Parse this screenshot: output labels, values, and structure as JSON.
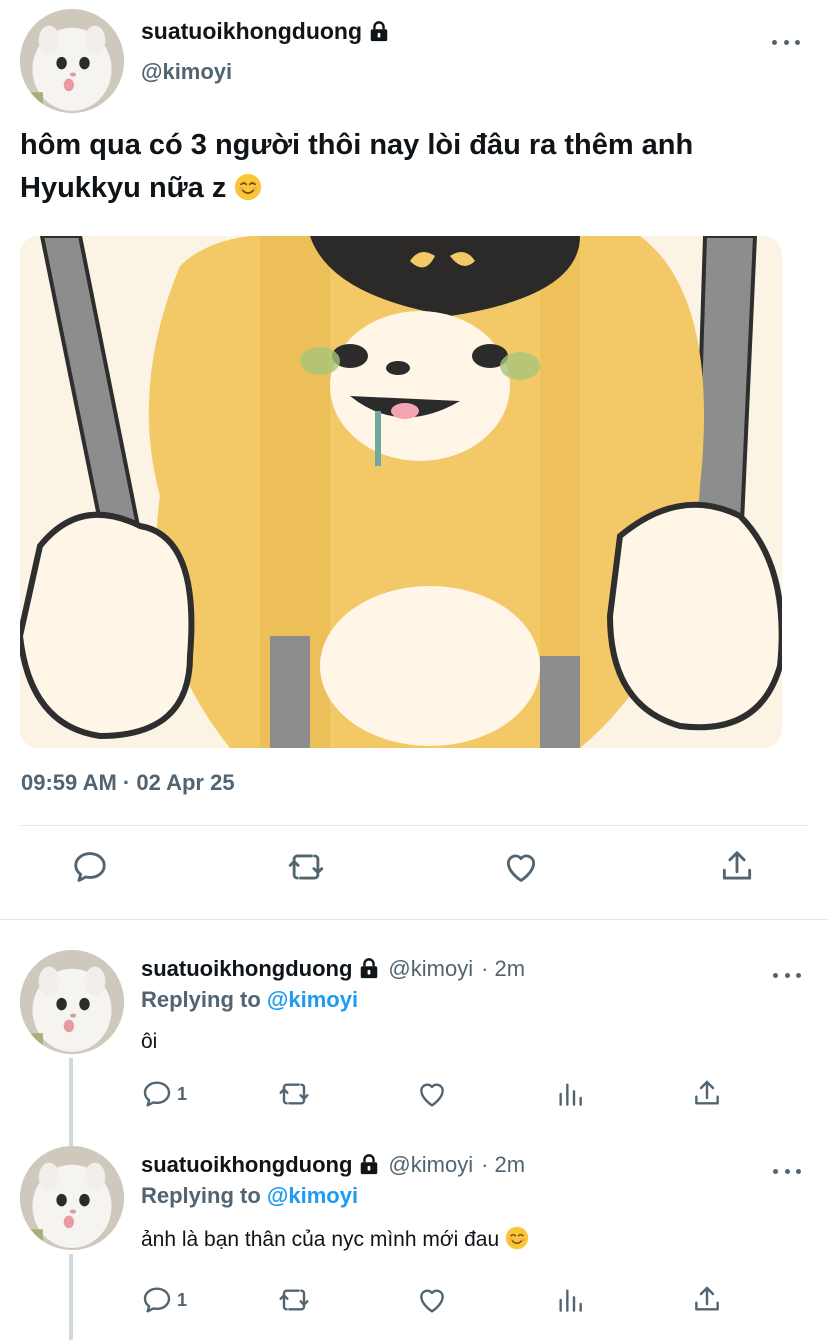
{
  "main_tweet": {
    "display_name": "suatuoikhongduong",
    "handle": "@kimoyi",
    "text": "hôm qua có 3 người thôi nay lòi đâu ra thêm anh Hyukkyu nữa z",
    "timestamp": "09:59 AM · 02 Apr 25",
    "icons": [
      "lock-icon",
      "more-icon",
      "smiling-face-emoji",
      "reply-icon",
      "retweet-icon",
      "like-icon",
      "share-icon"
    ]
  },
  "replies": [
    {
      "display_name": "suatuoikhongduong",
      "handle": "@kimoyi",
      "time": "· 2m",
      "replying_prefix": "Replying to",
      "replying_to": "@kimoyi",
      "text": "ôi",
      "reply_count": "1"
    },
    {
      "display_name": "suatuoikhongduong",
      "handle": "@kimoyi",
      "time": "· 2m",
      "replying_prefix": "Replying to",
      "replying_to": "@kimoyi",
      "text": "ảnh là bạn thân của nyc mình mới đau",
      "reply_count": "1"
    }
  ],
  "colors": {
    "text_primary": "#0f1419",
    "text_secondary": "#536471",
    "accent": "#1d9bf0",
    "divider": "#e6e6e6"
  }
}
